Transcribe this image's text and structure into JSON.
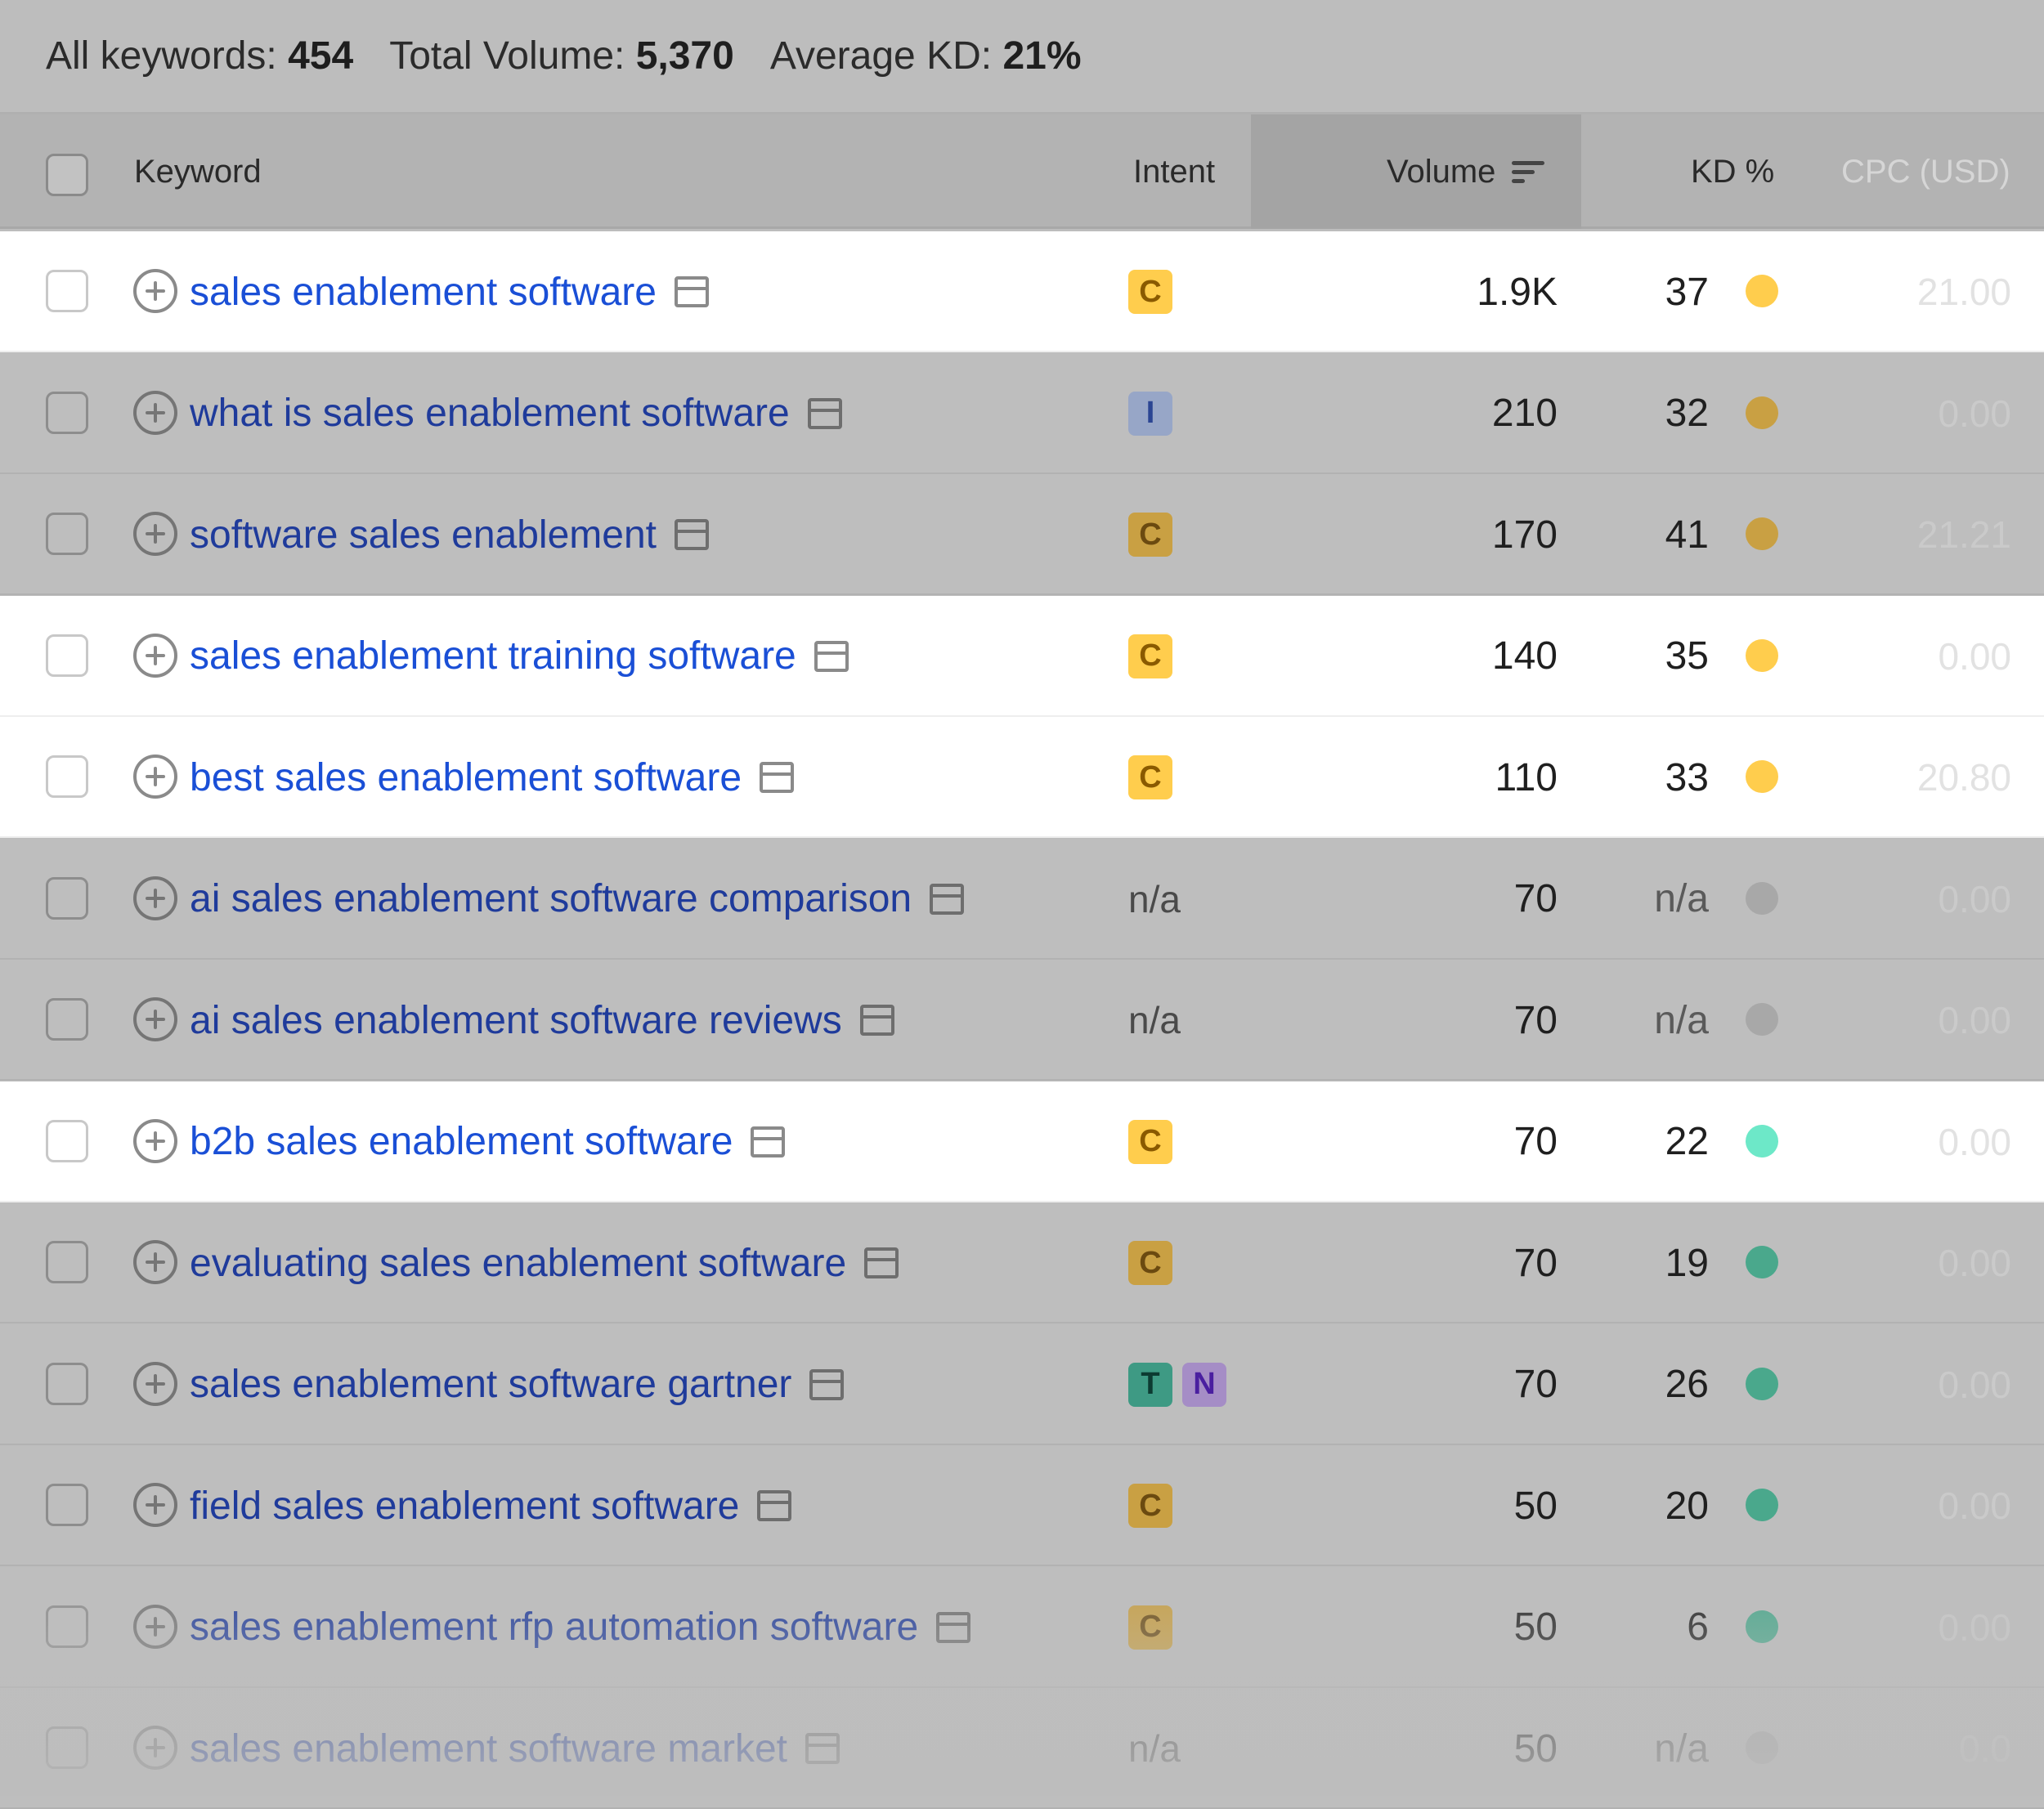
{
  "summary": {
    "all_keywords_label": "All keywords:",
    "all_keywords_value": "454",
    "total_volume_label": "Total Volume:",
    "total_volume_value": "5,370",
    "avg_kd_label": "Average KD:",
    "avg_kd_value": "21%"
  },
  "columns": {
    "keyword": "Keyword",
    "intent": "Intent",
    "volume": "Volume",
    "kd": "KD %",
    "cpc": "CPC (USD)"
  },
  "colors": {
    "kd_yellow": "#ffcd4d",
    "kd_yellow_dim": "#c9a043",
    "kd_teal_light": "#6de8c8",
    "kd_green": "#4aa88c",
    "kd_gray": "#a8a8a8"
  },
  "rows": [
    {
      "keyword": "sales enablement software",
      "intent": [
        "C"
      ],
      "volume": "1.9K",
      "kd": "37",
      "kd_color": "#ffcd4d",
      "cpc": "21.00",
      "highlighted": true
    },
    {
      "keyword": "what is sales enablement software",
      "intent": [
        "I"
      ],
      "volume": "210",
      "kd": "32",
      "kd_color": "#c9a043",
      "cpc": "0.00",
      "highlighted": false
    },
    {
      "keyword": "software sales enablement",
      "intent": [
        "C"
      ],
      "volume": "170",
      "kd": "41",
      "kd_color": "#c9a043",
      "cpc": "21.21",
      "highlighted": false
    },
    {
      "keyword": "sales enablement training software",
      "intent": [
        "C"
      ],
      "volume": "140",
      "kd": "35",
      "kd_color": "#ffcd4d",
      "cpc": "0.00",
      "highlighted": true
    },
    {
      "keyword": "best sales enablement software",
      "intent": [
        "C"
      ],
      "volume": "110",
      "kd": "33",
      "kd_color": "#ffcd4d",
      "cpc": "20.80",
      "highlighted": true
    },
    {
      "keyword": "ai sales enablement software comparison",
      "intent_text": "n/a",
      "intent": [],
      "volume": "70",
      "kd": "n/a",
      "kd_color": "#a8a8a8",
      "cpc": "0.00",
      "highlighted": false
    },
    {
      "keyword": "ai sales enablement software reviews",
      "intent_text": "n/a",
      "intent": [],
      "volume": "70",
      "kd": "n/a",
      "kd_color": "#a8a8a8",
      "cpc": "0.00",
      "highlighted": false
    },
    {
      "keyword": "b2b sales enablement software",
      "intent": [
        "C"
      ],
      "volume": "70",
      "kd": "22",
      "kd_color": "#6de8c8",
      "cpc": "0.00",
      "highlighted": true
    },
    {
      "keyword": "evaluating sales enablement software",
      "intent": [
        "C"
      ],
      "volume": "70",
      "kd": "19",
      "kd_color": "#4aa88c",
      "cpc": "0.00",
      "highlighted": false
    },
    {
      "keyword": "sales enablement software gartner",
      "intent": [
        "T",
        "N"
      ],
      "volume": "70",
      "kd": "26",
      "kd_color": "#4aa88c",
      "cpc": "0.00",
      "highlighted": false
    },
    {
      "keyword": "field sales enablement software",
      "intent": [
        "C"
      ],
      "volume": "50",
      "kd": "20",
      "kd_color": "#4aa88c",
      "cpc": "0.00",
      "highlighted": false
    },
    {
      "keyword": "sales enablement rfp automation software",
      "intent": [
        "C"
      ],
      "volume": "50",
      "kd": "6",
      "kd_color": "#4aa88c",
      "cpc": "0.00",
      "highlighted": false
    },
    {
      "keyword": "sales enablement software market",
      "intent_text": "n/a",
      "intent": [],
      "volume": "50",
      "kd": "n/a",
      "kd_color": "#a8a8a8",
      "cpc": "0.0",
      "highlighted": false
    }
  ]
}
